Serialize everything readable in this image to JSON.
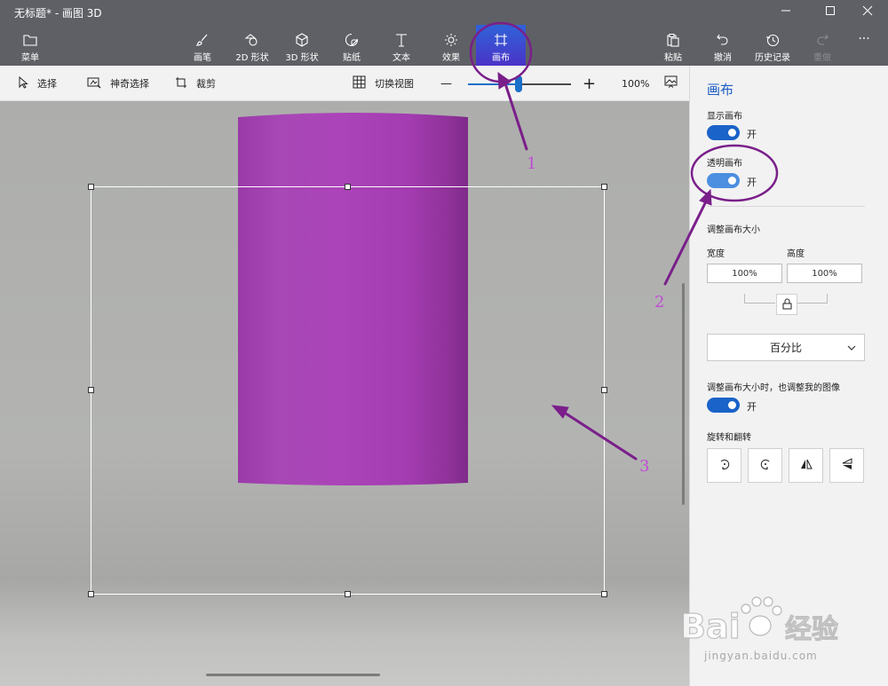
{
  "window": {
    "title": "无标题* - 画图 3D",
    "minimize_icon": "minimize-icon",
    "maximize_icon": "maximize-icon",
    "close_icon": "close-icon"
  },
  "ribbon": {
    "menu": "菜单",
    "tools": [
      {
        "label": "画笔",
        "icon": "brush-icon"
      },
      {
        "label": "2D 形状",
        "icon": "2d-shapes-icon"
      },
      {
        "label": "3D 形状",
        "icon": "3d-shapes-icon"
      },
      {
        "label": "贴纸",
        "icon": "stickers-icon"
      },
      {
        "label": "文本",
        "icon": "text-icon"
      },
      {
        "label": "效果",
        "icon": "effects-icon"
      },
      {
        "label": "画布",
        "icon": "canvas-icon",
        "active": true
      }
    ],
    "right": [
      {
        "label": "粘贴",
        "icon": "paste-icon"
      },
      {
        "label": "撤消",
        "icon": "undo-icon"
      },
      {
        "label": "历史记录",
        "icon": "history-icon"
      },
      {
        "label": "重做",
        "icon": "redo-icon",
        "disabled": true
      }
    ],
    "more": "···",
    "active_color": "#3a4fd0"
  },
  "cmdbar": {
    "select": "选择",
    "magic_select": "神奇选择",
    "crop": "裁剪",
    "switch_view": "切换视图",
    "zoom_minus": "—",
    "zoom_plus": "+",
    "zoom": "100%",
    "zoom_level": 0.48
  },
  "panel": {
    "title": "画布",
    "show_canvas_label": "显示画布",
    "show_canvas_state": "开",
    "transparent_canvas_label": "透明画布",
    "transparent_canvas_state": "开",
    "resize_label": "调整画布大小",
    "width_label": "宽度",
    "height_label": "高度",
    "width_value": "100%",
    "height_value": "100%",
    "unit_select": "百分比",
    "resize_image_label": "调整画布大小时，也调整我的图像",
    "resize_image_state": "开",
    "rotate_label": "旋转和翻转"
  },
  "annotations": {
    "n1": "1",
    "n2": "2",
    "n3": "3",
    "color": "#7a1f8a"
  },
  "watermark": {
    "logo": "Baidu经验",
    "domain": "jingyan.baidu.com"
  },
  "colors": {
    "cylinder": "#a23fb0",
    "accent": "#1a63c8"
  }
}
